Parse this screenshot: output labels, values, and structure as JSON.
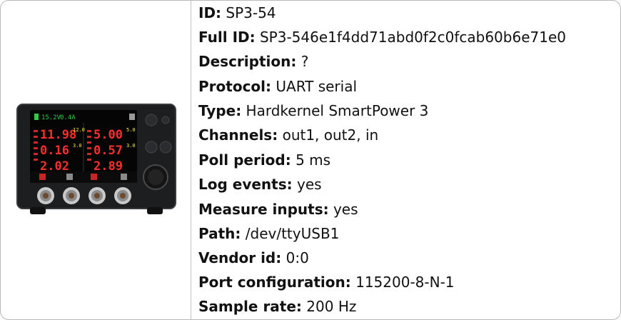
{
  "device": {
    "status_voltage": "15.2V",
    "status_current": "0.4A",
    "channel1": {
      "volts": "11.98",
      "watts": "2.02",
      "amps": "0.16",
      "set_volts": "12.0",
      "set_amps": "3.0"
    },
    "channel2": {
      "volts": "5.00",
      "watts": "2.89",
      "amps": "0.57",
      "set_volts": "5.0",
      "set_amps": "3.0"
    }
  },
  "info": [
    {
      "label": "ID:",
      "value": "SP3-54"
    },
    {
      "label": "Full ID:",
      "value": "SP3-546e1f4dd71abd0f2c0fcab60b6e71e0"
    },
    {
      "label": "Description:",
      "value": "?"
    },
    {
      "label": "Protocol:",
      "value": "UART serial"
    },
    {
      "label": "Type:",
      "value": "Hardkernel SmartPower 3"
    },
    {
      "label": "Channels:",
      "value": "out1, out2, in"
    },
    {
      "label": "Poll period:",
      "value": "5 ms"
    },
    {
      "label": "Log events:",
      "value": "yes"
    },
    {
      "label": "Measure inputs:",
      "value": "yes"
    },
    {
      "label": "Path:",
      "value": "/dev/ttyUSB1"
    },
    {
      "label": "Vendor id:",
      "value": "0:0"
    },
    {
      "label": "Port configuration:",
      "value": "115200-8-N-1"
    },
    {
      "label": "Sample rate:",
      "value": "200 Hz"
    }
  ]
}
